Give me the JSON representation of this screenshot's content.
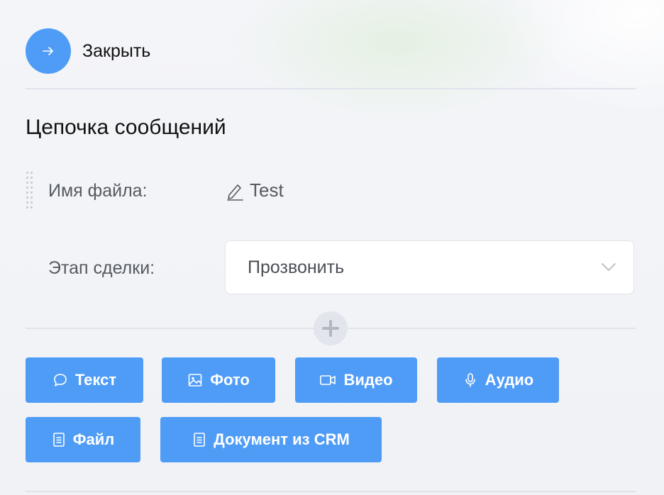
{
  "header": {
    "close_label": "Закрыть",
    "close_icon": "arrow-right-icon",
    "accent_color": "#4f9cf7"
  },
  "section": {
    "title": "Цепочка сообщений"
  },
  "fields": {
    "file_name": {
      "label": "Имя файла:",
      "value": "Test",
      "icon": "pencil-icon"
    },
    "deal_stage": {
      "label": "Этап сделки:",
      "value": "Прозвонить",
      "icon": "chevron-down-icon"
    }
  },
  "add_step": {
    "icon": "plus-icon"
  },
  "buttons": [
    {
      "label": "Текст",
      "icon": "chat-bubble-icon"
    },
    {
      "label": "Фото",
      "icon": "image-icon"
    },
    {
      "label": "Видео",
      "icon": "video-camera-icon"
    },
    {
      "label": "Аудио",
      "icon": "microphone-icon"
    },
    {
      "label": "Файл",
      "icon": "document-icon"
    },
    {
      "label": "Документ из CRM",
      "icon": "document-icon"
    }
  ]
}
